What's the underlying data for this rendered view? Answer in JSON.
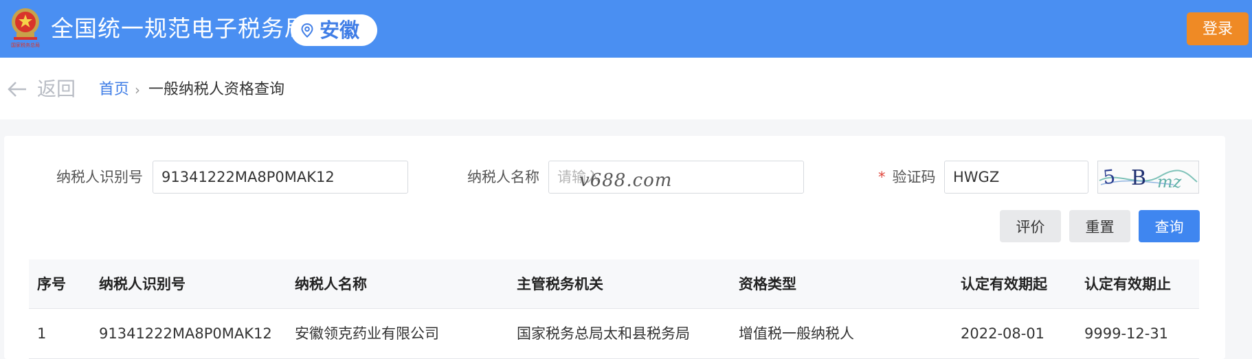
{
  "header": {
    "site_title": "全国统一规范电子税务局",
    "region": "安徽",
    "login_label": "登录",
    "emblem_text": "国家税务总局",
    "primary_color": "#4a8ff2",
    "login_color": "#ef8a25"
  },
  "nav": {
    "back_label": "返回",
    "breadcrumb_home": "首页",
    "breadcrumb_separator": "›",
    "breadcrumb_current": "一般纳税人资格查询"
  },
  "form": {
    "taxpayer_id_label": "纳税人识别号",
    "taxpayer_id_value": "91341222MA8P0MAK12",
    "taxpayer_name_label": "纳税人名称",
    "taxpayer_name_placeholder": "请输入",
    "captcha_required_mark": "*",
    "captcha_label": "验证码",
    "captcha_value": "HWGZ",
    "captcha_image_text": "5Bmz",
    "watermark": "v688.com"
  },
  "buttons": {
    "evaluate": "评价",
    "reset": "重置",
    "query": "查询"
  },
  "table": {
    "columns": [
      "序号",
      "纳税人识别号",
      "纳税人名称",
      "主管税务机关",
      "资格类型",
      "认定有效期起",
      "认定有效期止"
    ],
    "rows": [
      [
        "1",
        "91341222MA8P0MAK12",
        "安徽领克药业有限公司",
        "国家税务总局太和县税务局",
        "增值税一般纳税人",
        "2022-08-01",
        "9999-12-31"
      ]
    ]
  }
}
